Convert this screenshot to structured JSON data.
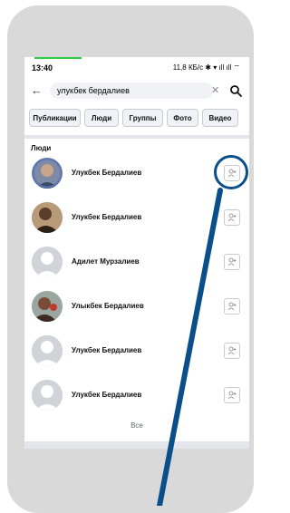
{
  "status_bar": {
    "time": "13:40",
    "right_text": "11,8 КБ/с ✱ ▾ ıll ıll ⌔"
  },
  "search": {
    "value": "улукбек бердалиев"
  },
  "filters": [
    {
      "label": "Публикации"
    },
    {
      "label": "Люди"
    },
    {
      "label": "Группы"
    },
    {
      "label": "Фото"
    },
    {
      "label": "Видео"
    }
  ],
  "section": {
    "title": "Люди"
  },
  "people": [
    {
      "name": "Улукбек Бердалиев"
    },
    {
      "name": "Улукбек Бердалиев"
    },
    {
      "name": "Адилет Мурзалиев"
    },
    {
      "name": "Улыкбек Бердалиев"
    },
    {
      "name": "Улукбек Бердалиев"
    },
    {
      "name": "Улукбек Бердалиев"
    }
  ],
  "all_link": "Все",
  "colors": {
    "highlight": "#0b4f8a",
    "frame": "#d9d9d9",
    "chip_bg": "#f0f2f5"
  }
}
